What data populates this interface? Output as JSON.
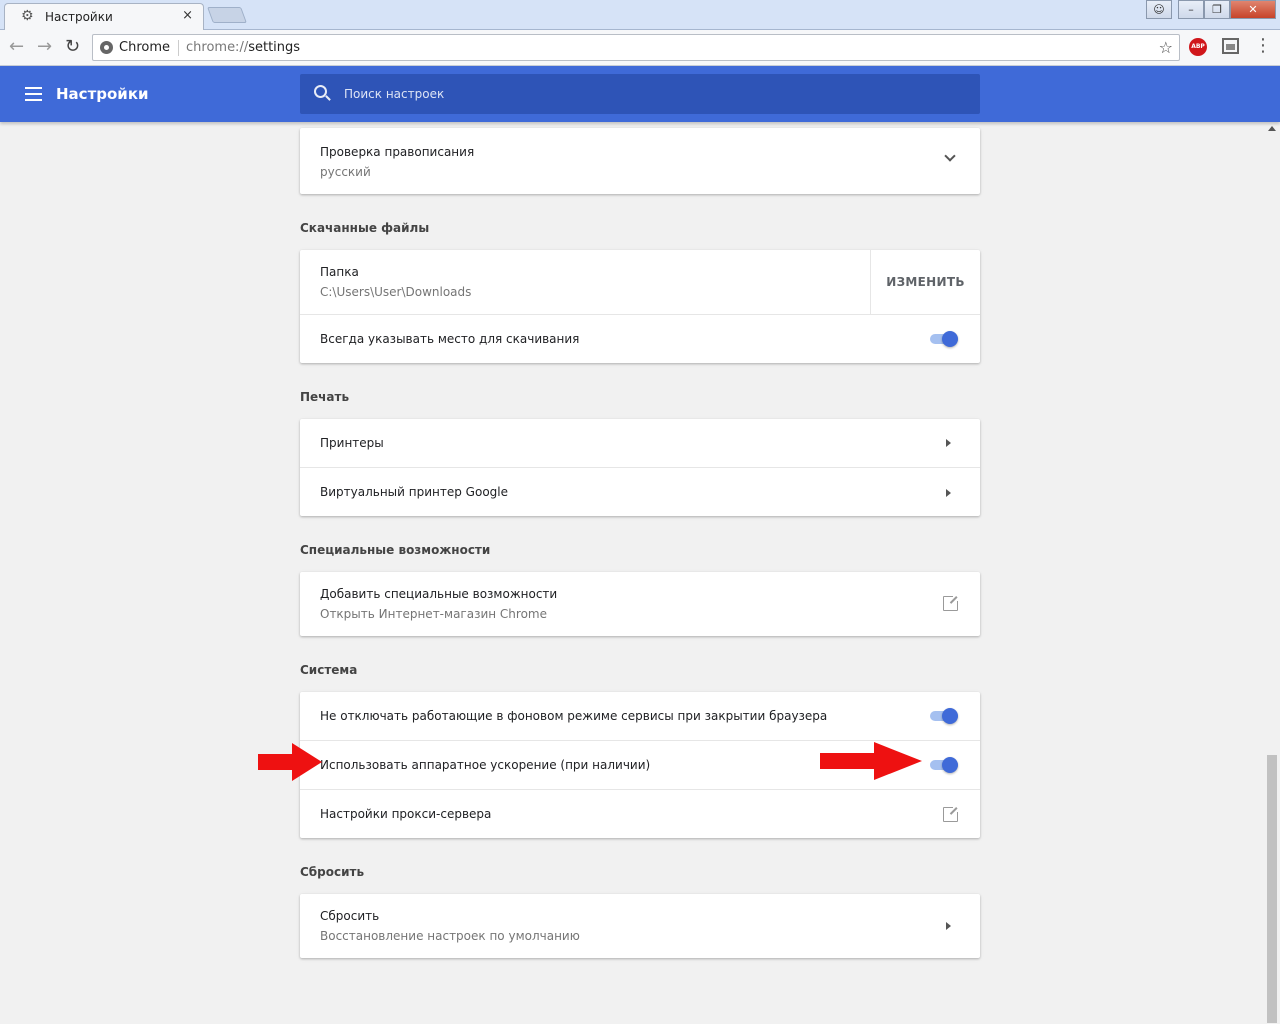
{
  "browser": {
    "tab_title": "Настройки",
    "tab_close": "×",
    "omnibox_chip": "Chrome",
    "url_scheme": "chrome://",
    "url_path": "settings",
    "abp_label": "ABP",
    "window_buttons": {
      "minimize": "–",
      "restore": "❐",
      "close": "✕",
      "user": "☺"
    }
  },
  "header": {
    "title": "Настройки",
    "search_placeholder": "Поиск настроек"
  },
  "sections": {
    "spellcheck": {
      "label": "Проверка правописания",
      "sub": "русский"
    },
    "downloads": {
      "title": "Скачанные файлы",
      "folder_label": "Папка",
      "folder_path": "C:\\Users\\User\\Downloads",
      "change_button": "ИЗМЕНИТЬ",
      "ask_location_label": "Всегда указывать место для скачивания",
      "ask_location_enabled": true
    },
    "printing": {
      "title": "Печать",
      "printers_label": "Принтеры",
      "cloud_print_label": "Виртуальный принтер Google"
    },
    "accessibility": {
      "title": "Специальные возможности",
      "add_label": "Добавить специальные возможности",
      "add_sub": "Открыть Интернет-магазин Chrome"
    },
    "system": {
      "title": "Система",
      "background_apps_label": "Не отключать работающие в фоновом режиме сервисы при закрытии браузера",
      "background_apps_enabled": true,
      "hw_accel_label": "Использовать аппаратное ускорение (при наличии)",
      "hw_accel_enabled": true,
      "proxy_label": "Настройки прокси-сервера"
    },
    "reset": {
      "title": "Сбросить",
      "reset_label": "Сбросить",
      "reset_sub": "Восстановление настроек по умолчанию"
    }
  },
  "colors": {
    "header_blue": "#3f6ad8",
    "search_blue": "#2e54b7",
    "toggle_on": "#3f6ad8",
    "annotation_red": "#ee1111"
  }
}
